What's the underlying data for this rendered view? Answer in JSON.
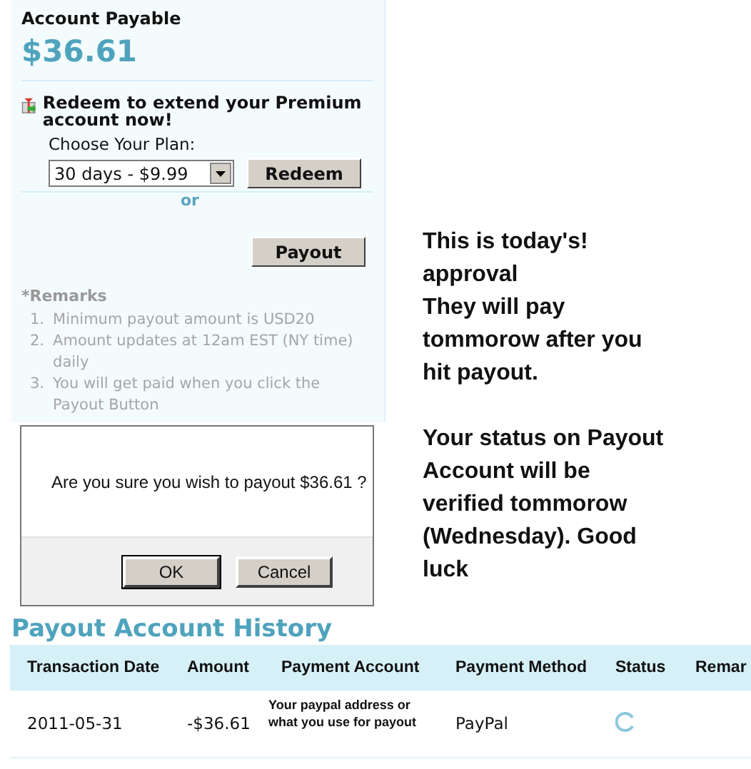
{
  "panel": {
    "title": "Account Payable",
    "amount": "$36.61",
    "redeem_heading": "Redeem to extend your Premium account now!",
    "plan_label": "Choose Your Plan:",
    "plan_value": "30 days - $9.99",
    "redeem_button": "Redeem",
    "or": "or",
    "payout_button": "Payout",
    "remarks_title": "*Remarks",
    "remarks": [
      {
        "number": "1.",
        "text": "Minimum payout amount is USD20"
      },
      {
        "number": "2.",
        "text": "Amount updates at 12am EST (NY time) daily"
      },
      {
        "number": "3.",
        "text": "You will get paid when you click the Payout Button"
      }
    ]
  },
  "note": [
    [
      "This is today's!",
      "approval",
      "They will pay tommorow after you hit payout."
    ],
    [
      "Your status on Payout Account will be verified tommorow (Wednesday). Good luck"
    ]
  ],
  "dialog": {
    "message": "Are you sure you wish to payout $36.61 ?",
    "buttons": [
      "OK",
      "Cancel"
    ]
  },
  "history": {
    "title": "Payout Account History",
    "columns": [
      "Transaction Date",
      "Amount",
      "Payment Account",
      "Payment Method",
      "Status",
      "Remar"
    ],
    "rows": [
      {
        "date": "2011-05-31",
        "amount": "-$36.61",
        "account": "Your paypal address or what you use for payout",
        "method": "PayPal"
      }
    ]
  }
}
